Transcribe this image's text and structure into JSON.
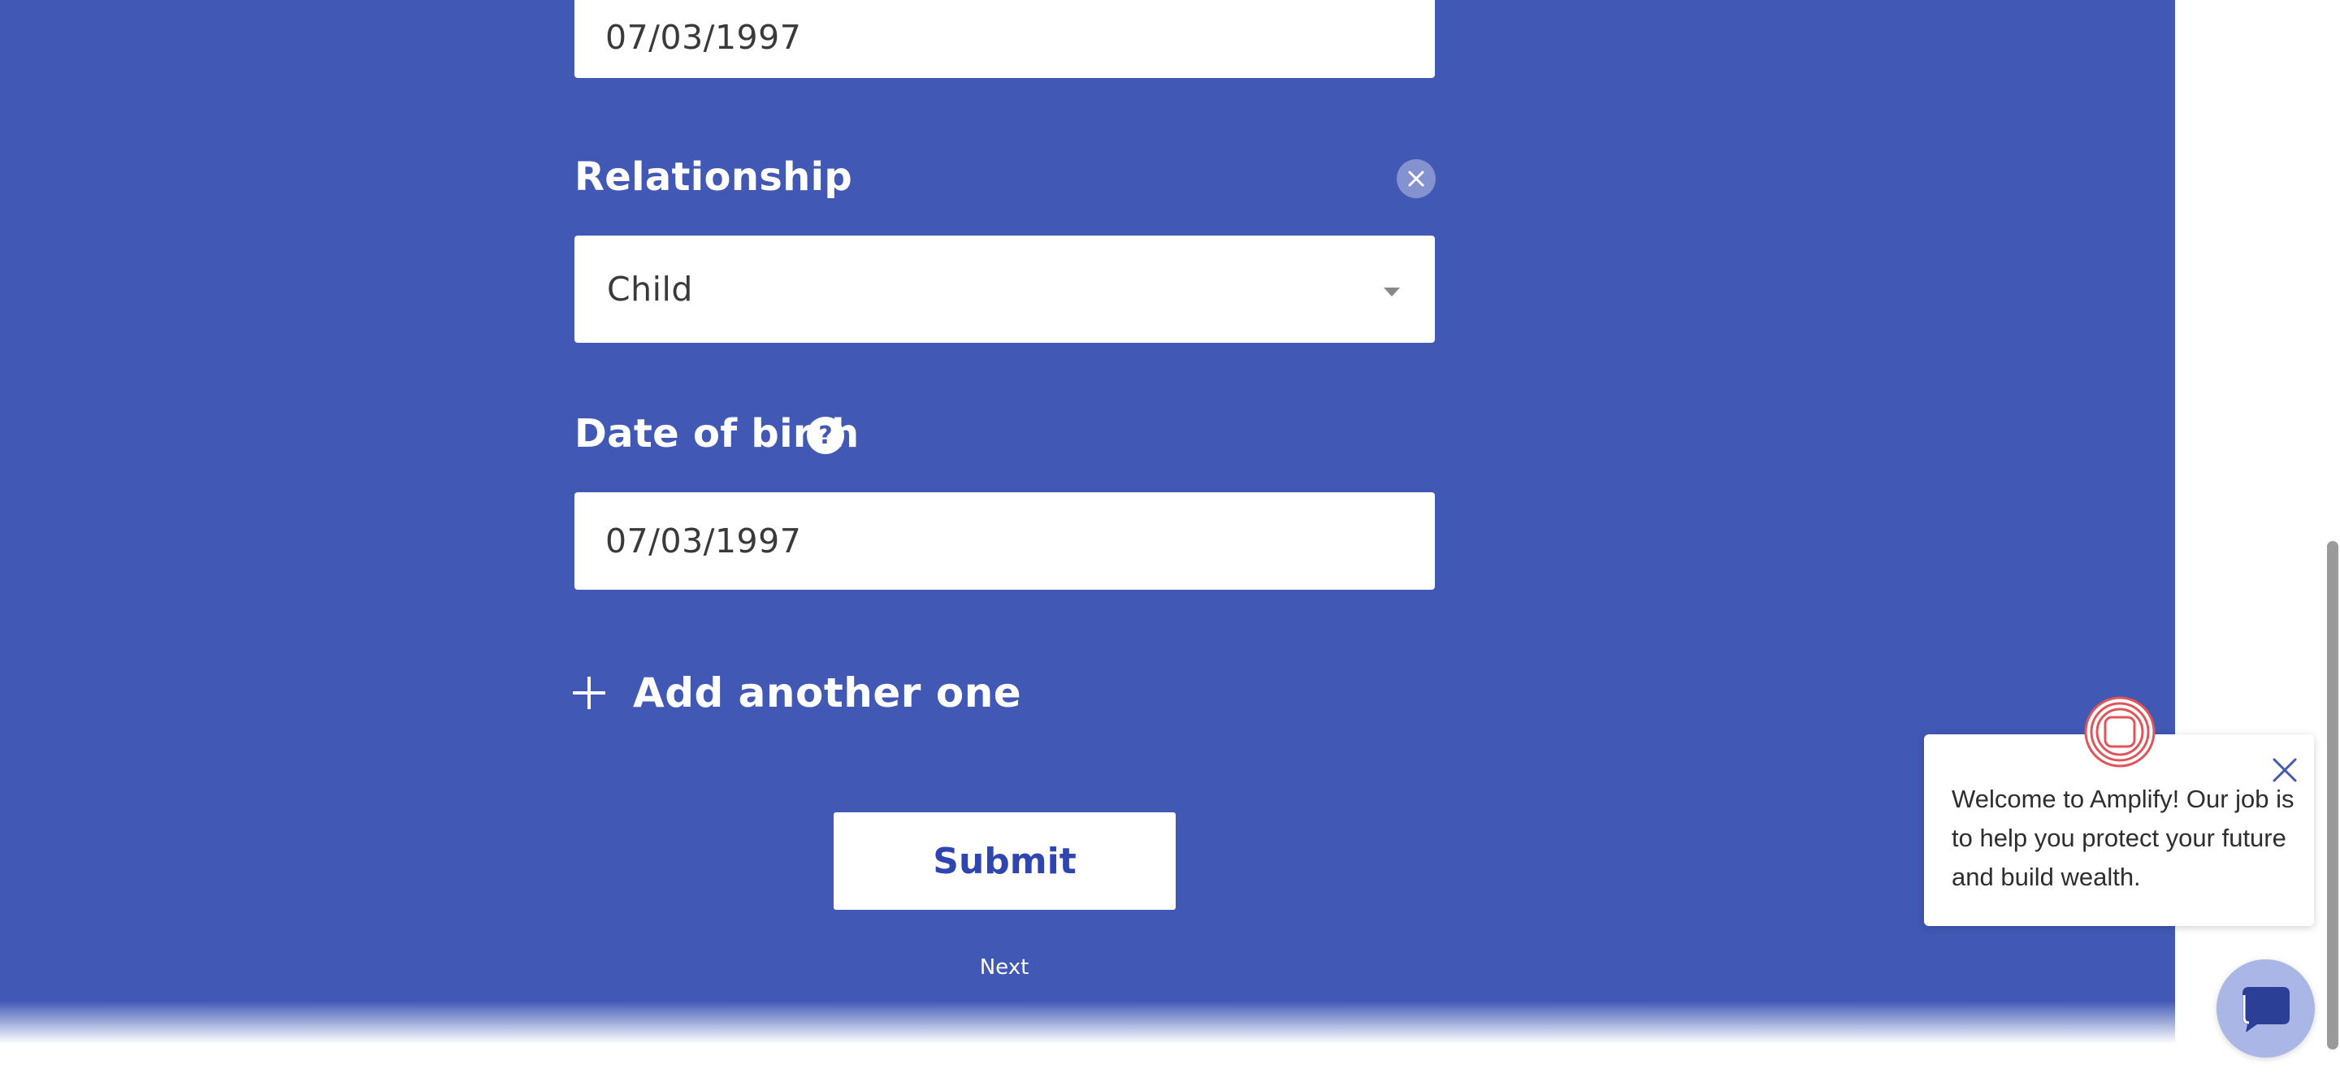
{
  "form": {
    "dob_top_value": "07/03/1997",
    "relationship_label": "Relationship",
    "relationship_value": "Child",
    "dob_label": "Date of birth",
    "help_glyph": "?",
    "dob_value": "07/03/1997",
    "add_another_label": "Add another one",
    "submit_label": "Submit",
    "next_label": "Next"
  },
  "chat": {
    "welcome_text": "Welcome to Amplify! Our job is to help you protect your future and build wealth."
  },
  "colors": {
    "panel_background": "#4258b5",
    "submit_text": "#2f46b0",
    "logo_red": "#e0545a",
    "chat_button": "#aab7e6"
  },
  "icons": {
    "remove": "close-icon",
    "dropdown": "chevron-down-icon",
    "help": "question-icon",
    "add": "plus-icon",
    "chat_close": "close-icon",
    "logo": "amplify-logo-icon",
    "chat": "chat-bubble-icon"
  }
}
